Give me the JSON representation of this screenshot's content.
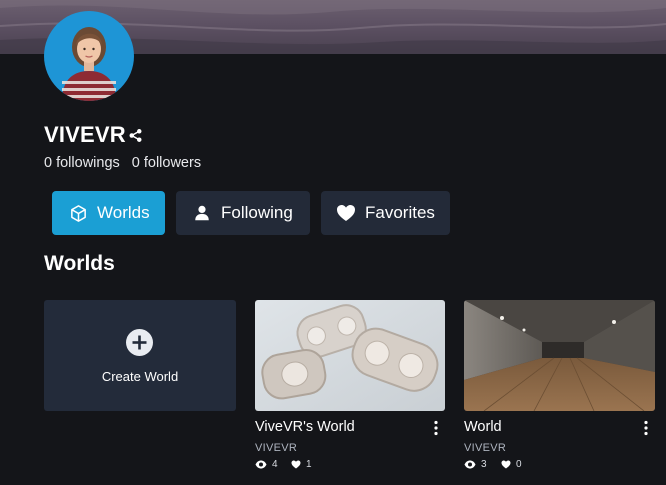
{
  "profile": {
    "username": "VIVEVR",
    "followings_text": "0 followings",
    "followers_text": "0 followers"
  },
  "tabs": [
    {
      "label": "Worlds",
      "icon": "cube-icon",
      "active": true
    },
    {
      "label": "Following",
      "icon": "person-icon",
      "active": false
    },
    {
      "label": "Favorites",
      "icon": "heart-icon",
      "active": false
    }
  ],
  "section": {
    "title": "Worlds"
  },
  "create_card": {
    "label": "Create World",
    "icon": "plus-circle-icon"
  },
  "worlds": [
    {
      "title": "ViveVR's World",
      "owner": "VIVEVR",
      "views": "4",
      "likes": "1"
    },
    {
      "title": "World",
      "owner": "VIVEVR",
      "views": "3",
      "likes": "0"
    }
  ],
  "colors": {
    "background": "#141519",
    "accent": "#1b9fd4",
    "card": "#232b3a",
    "avatar_bg": "#1e95d6"
  }
}
